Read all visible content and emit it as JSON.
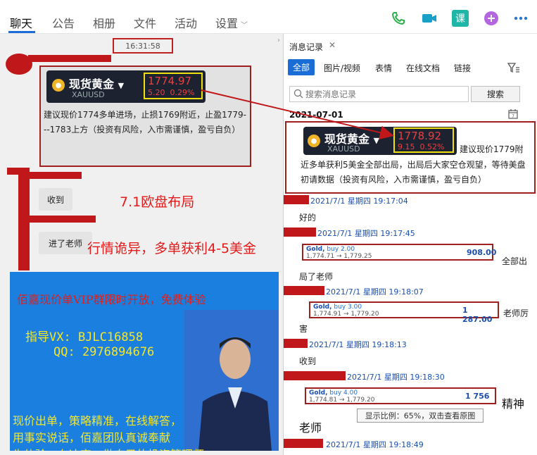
{
  "tabs": [
    {
      "label": "聊天",
      "active": true
    },
    {
      "label": "公告"
    },
    {
      "label": "相册"
    },
    {
      "label": "文件"
    },
    {
      "label": "活动"
    },
    {
      "label": "设置"
    }
  ],
  "toolbar_icons": [
    "phone-icon",
    "video-icon",
    "course-icon",
    "plus-icon",
    "more-icon"
  ],
  "toolbar_course_label": "课",
  "chat": {
    "time": "16:31:58",
    "quote": {
      "name": "现货黄金",
      "code": "XAUUSD",
      "price": "1774.97",
      "change": "5.20",
      "pct": "0.29%"
    },
    "message": "建议现价1774多单进场，止损1769附近，止盈1779---1783上方（投资有风险，入市需谨慎，盈亏自负）",
    "reply1": "收到",
    "reply2": "进了老师",
    "overlay1": "7.1欧盘布局",
    "overlay2": "行情诡异，多单获利4-5美金",
    "promo": {
      "headline": "佰嘉现价单VIP群限时开放，免费体验",
      "vx": "指导VX:  BJLC16858",
      "qq": "QQ: 2976894676",
      "line1": "现价出单，策略精准，在线解答，",
      "line2": "用事实说话，佰嘉团队真诚奉献",
      "line3": "先体验，在决定。做自己的投资管理师"
    }
  },
  "history": {
    "title": "消息记录",
    "filters": [
      "全部",
      "图片/视频",
      "表情",
      "在线文档",
      "链接"
    ],
    "search_placeholder": "搜索消息记录",
    "search_button": "搜索",
    "date": "2021-07-01",
    "quote": {
      "name": "现货黄金",
      "code": "XAUUSD",
      "price": "1778.92",
      "change": "9.15",
      "pct": "0.52%"
    },
    "card_text_1": "建议现价1779附",
    "card_text_2": "近多单获利5美金全部出局，出局后大家空仓观望，等待美盘初请数据（投资有风险，入市需谨慎，盈亏自负）",
    "entries": [
      {
        "meta": "2021/7/1 星期四 19:17:04",
        "text": "好的"
      },
      {
        "meta": "2021/7/1 星期四 19:17:45",
        "trade": {
          "title": "Gold,",
          "action": "buy 2.00",
          "range": "1,774.71 → 1,779.25",
          "amount": "908.00"
        },
        "after": "全部出",
        "text": "局了老师"
      },
      {
        "meta": "2021/7/1 星期四 19:18:07",
        "trade": {
          "title": "Gold,",
          "action": "buy 3.00",
          "range": "1,774.91 → 1,779.20",
          "amount": "1 287.00"
        },
        "after": "老师厉",
        "text": "害"
      },
      {
        "meta": "2021/7/1 星期四 19:18:13",
        "text": "收到"
      },
      {
        "meta": "2021/7/1 星期四 19:18:30",
        "trade": {
          "title": "Gold,",
          "action": "buy 4.00",
          "range": "1,774.81 → 1,779.20",
          "amount": "1 756"
        },
        "after": "精神",
        "text": "老师"
      },
      {
        "meta": "2021/7/1 星期四 19:18:49"
      }
    ],
    "zoom_tip": "显示比例：65%，双击查看原图"
  },
  "colors": {
    "accent": "#1a6dd6",
    "annotation_red": "#c0171a",
    "quote_bg": "#1d2230",
    "promo_bg": "#1b7fe0"
  }
}
